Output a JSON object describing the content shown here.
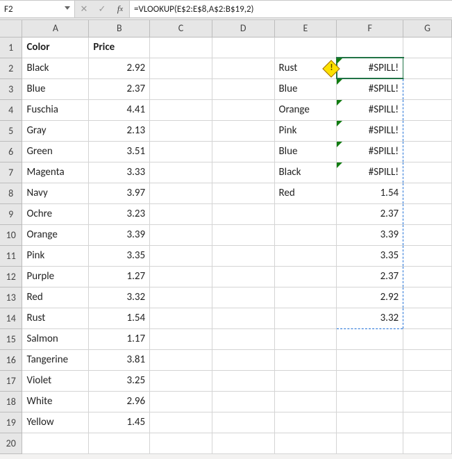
{
  "name_box": "F2",
  "formula": "=VLOOKUP(E$2:E$8,A$2:B$19,2)",
  "columns": [
    "A",
    "B",
    "C",
    "D",
    "E",
    "F",
    "G"
  ],
  "headers": {
    "A": "Color",
    "B": "Price"
  },
  "tableA": [
    {
      "color": "Black",
      "price": "2.92"
    },
    {
      "color": "Blue",
      "price": "2.37"
    },
    {
      "color": "Fuschia",
      "price": "4.41"
    },
    {
      "color": "Gray",
      "price": "2.13"
    },
    {
      "color": "Green",
      "price": "3.51"
    },
    {
      "color": "Magenta",
      "price": "3.33"
    },
    {
      "color": "Navy",
      "price": "3.97"
    },
    {
      "color": "Ochre",
      "price": "3.23"
    },
    {
      "color": "Orange",
      "price": "3.39"
    },
    {
      "color": "Pink",
      "price": "3.35"
    },
    {
      "color": "Purple",
      "price": "1.27"
    },
    {
      "color": "Red",
      "price": "3.32"
    },
    {
      "color": "Rust",
      "price": "1.54"
    },
    {
      "color": "Salmon",
      "price": "1.17"
    },
    {
      "color": "Tangerine",
      "price": "3.81"
    },
    {
      "color": "Violet",
      "price": "3.25"
    },
    {
      "color": "White",
      "price": "2.96"
    },
    {
      "color": "Yellow",
      "price": "1.45"
    }
  ],
  "lookupE": [
    "Rust",
    "Blue",
    "Orange",
    "Pink",
    "Blue",
    "Black",
    "Red"
  ],
  "resultF": [
    "#SPILL!",
    "#SPILL!",
    "#SPILL!",
    "#SPILL!",
    "#SPILL!",
    "#SPILL!",
    "1.54",
    "2.37",
    "3.39",
    "3.35",
    "2.37",
    "2.92",
    "3.32"
  ],
  "spill_error_rows": [
    2,
    3,
    4,
    5,
    6,
    7
  ],
  "spill_range": {
    "start": 2,
    "end": 14
  }
}
